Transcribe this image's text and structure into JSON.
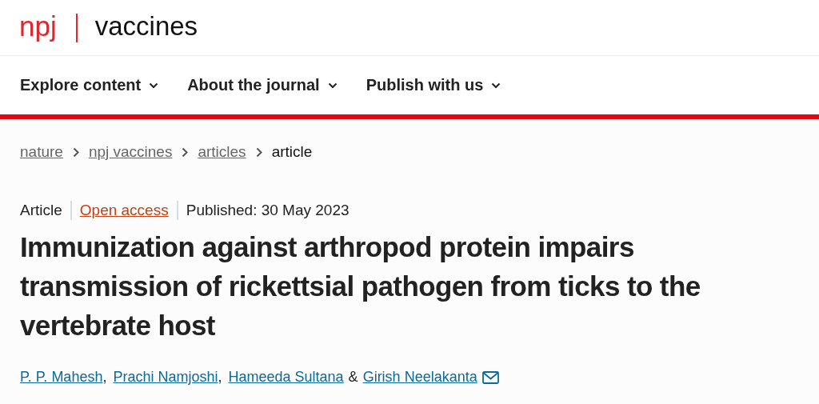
{
  "header": {
    "brand": "npj",
    "journal": "vaccines"
  },
  "nav": [
    {
      "label": "Explore content"
    },
    {
      "label": "About the journal"
    },
    {
      "label": "Publish with us"
    }
  ],
  "breadcrumb": [
    {
      "label": "nature",
      "kind": "link"
    },
    {
      "label": "npj vaccines",
      "kind": "link"
    },
    {
      "label": "articles",
      "kind": "link"
    },
    {
      "label": "article",
      "kind": "current"
    }
  ],
  "meta": {
    "type": "Article",
    "access": "Open access",
    "published": "Published: 30 May 2023"
  },
  "title": "Immunization against arthropod protein impairs transmission of rickettsial pathogen from ticks to the vertebrate host",
  "authors": [
    {
      "name": "P. P. Mahesh",
      "separator": ",",
      "email": false
    },
    {
      "name": "Prachi Namjoshi",
      "separator": ",",
      "email": false
    },
    {
      "name": "Hameeda Sultana",
      "separator": "&",
      "email": false
    },
    {
      "name": "Girish Neelakanta",
      "email": true
    }
  ]
}
